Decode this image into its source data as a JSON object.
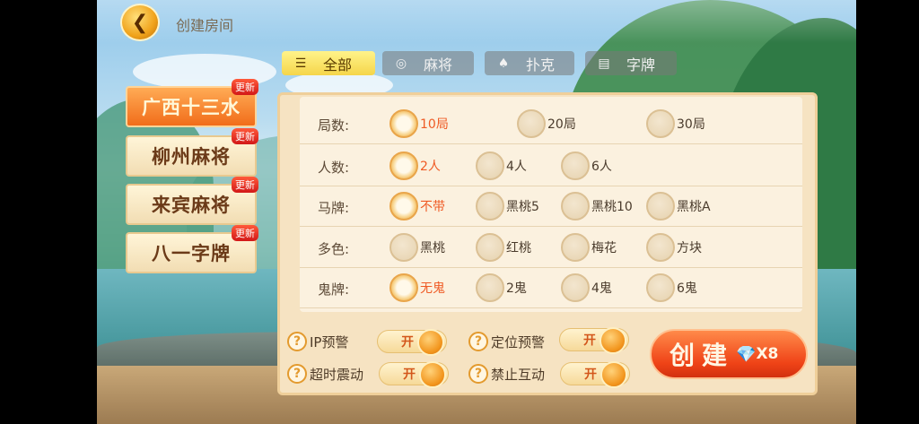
{
  "header": {
    "title": "创建房间",
    "back_icon": "back-arrow-icon"
  },
  "tabs": [
    {
      "label": "全部",
      "icon": "list-icon",
      "active": true
    },
    {
      "label": "麻将",
      "icon": "mahjong-tile-icon",
      "active": false
    },
    {
      "label": "扑克",
      "icon": "playing-cards-icon",
      "active": false
    },
    {
      "label": "字牌",
      "icon": "card-tile-icon",
      "active": false
    }
  ],
  "games": [
    {
      "label": "广西十三水",
      "badge": "更新",
      "active": true
    },
    {
      "label": "柳州麻将",
      "badge": "更新",
      "active": false
    },
    {
      "label": "来宾麻将",
      "badge": "更新",
      "active": false
    },
    {
      "label": "八一字牌",
      "badge": "更新",
      "active": false
    }
  ],
  "rules": [
    {
      "label": "局数:",
      "options": [
        "10局",
        "20局",
        "30局"
      ],
      "selected": 0
    },
    {
      "label": "人数:",
      "options": [
        "2人",
        "4人",
        "6人"
      ],
      "selected": 0
    },
    {
      "label": "马牌:",
      "options": [
        "不带",
        "黑桃5",
        "黑桃10",
        "黑桃A"
      ],
      "selected": 0
    },
    {
      "label": "多色:",
      "options": [
        "黑桃",
        "红桃",
        "梅花",
        "方块"
      ],
      "selected": -1
    },
    {
      "label": "鬼牌:",
      "options": [
        "无鬼",
        "2鬼",
        "4鬼",
        "6鬼"
      ],
      "selected": 0
    }
  ],
  "switches": {
    "ip_warning": {
      "label": "IP预警",
      "value": "开"
    },
    "location_warning": {
      "label": "定位预警",
      "value": "开"
    },
    "timeout_vibrate": {
      "label": "超时震动",
      "value": "开"
    },
    "no_interaction": {
      "label": "禁止互动",
      "value": "开"
    },
    "help_glyph": "?"
  },
  "create": {
    "label": "创建",
    "cost": "X8",
    "icon": "diamond-icon"
  },
  "colors": {
    "accent": "#ef4317",
    "selected_text": "#ef5a24",
    "panel": "#f6e3c2"
  }
}
